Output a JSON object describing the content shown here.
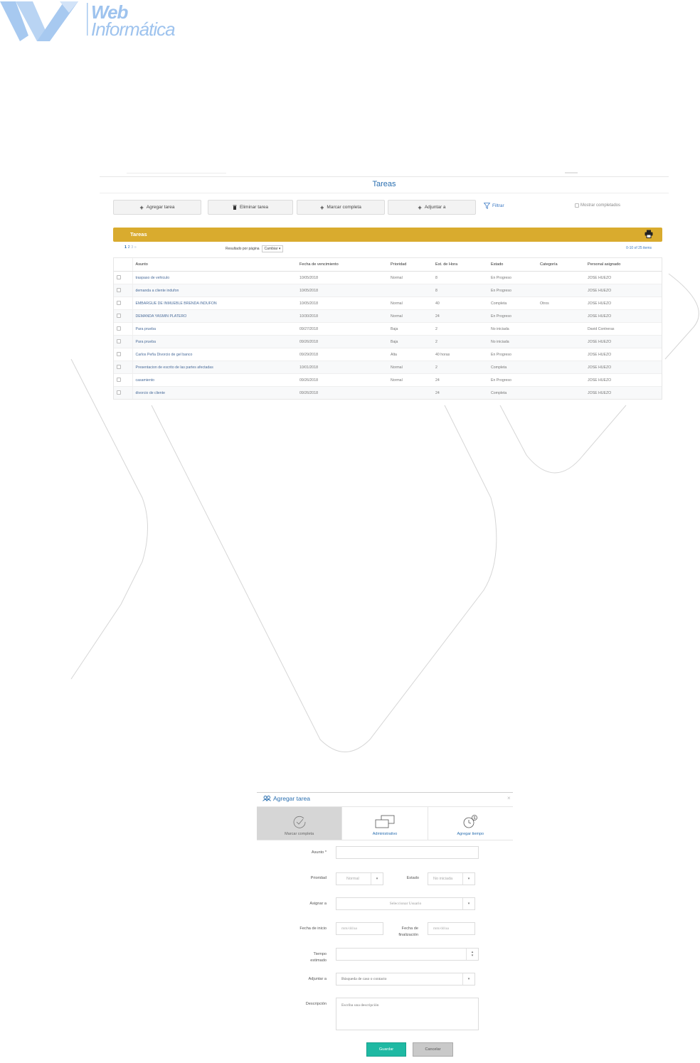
{
  "brand": {
    "line1": "Web",
    "line2": "Informática",
    "color": "#9ec3ee"
  },
  "page": {
    "title": "Tareas"
  },
  "toolbar": {
    "add_task": "Agregar tarea",
    "delete_task": "Eliminar tarea",
    "mark_complete": "Marcar completa",
    "attach_to": "Adjuntar a",
    "filter": "Filtrar",
    "show_completed": "Mostrar completados"
  },
  "panel": {
    "title": "Tareas",
    "accent": "#d9ab2e",
    "pages": [
      "1",
      "2",
      "3",
      "»"
    ],
    "per_page_label": "Resultado por página",
    "per_page_select": "Cambiar",
    "range": "0-10 of 25 items"
  },
  "table": {
    "columns": [
      "",
      "Asunto",
      "Fecha de vencimiento",
      "Prioridad",
      "Est. de Hora",
      "Estado",
      "Categoría",
      "Personal asignado"
    ],
    "rows": [
      [
        "traspaso de vehiculo",
        "10/05/2018",
        "Normal",
        "8",
        "En Progreso",
        "",
        "JOSE HUEZO"
      ],
      [
        "demanda a cliente indufon",
        "10/05/2018",
        "",
        "8",
        "En Progreso",
        "",
        "JOSE HUEZO"
      ],
      [
        "EMBARGUE DE INMUEBLE BRENDA INDUFON",
        "10/05/2018",
        "Normal",
        "40",
        "Completa",
        "Otros",
        "JOSE HUEZO"
      ],
      [
        "DEMANDA YASMIN PLATERO",
        "10/30/2018",
        "Normal",
        "24",
        "En Progreso",
        "",
        "JOSE HUEZO"
      ],
      [
        "Para prueba",
        "09/27/2018",
        "Baja",
        "2",
        "No iniciada",
        "",
        "David Contreras"
      ],
      [
        "Para prueba",
        "09/26/2018",
        "Baja",
        "2",
        "No iniciada",
        "",
        "JOSE HUEZO"
      ],
      [
        "Carlos Peña Divorcio de gel banco",
        "09/29/2018",
        "Alta",
        "40 horas",
        "En Progreso",
        "",
        "JOSE HUEZO"
      ],
      [
        "Presentacion de escrito de las partes afectadas",
        "10/01/2018",
        "Normal",
        "2",
        "Completa",
        "",
        "JOSE HUEZO"
      ],
      [
        "casamiento",
        "09/26/2018",
        "Normal",
        "24",
        "En Progreso",
        "",
        "JOSE HUEZO"
      ],
      [
        "divorcio de cliente",
        "09/26/2018",
        "",
        "24",
        "Completa",
        "",
        "JOSE HUEZO"
      ]
    ]
  },
  "modal": {
    "title": "Agregar tarea",
    "close": "×",
    "tabs": [
      "Marcar completa",
      "Administrativo",
      "Agregar tiempo"
    ],
    "fields": {
      "subject_label": "Asunto *",
      "priority_label": "Prioridad",
      "priority_value": "Normal",
      "status_label": "Estado",
      "status_value": "No iniciada",
      "assign_label": "Asignar a",
      "assign_value": "Seleccionar Usuario",
      "start_label": "Fecha de inicio",
      "start_placeholder": "mm/dd/aa",
      "end_label_1": "Fecha de",
      "end_label_2": "finalización",
      "end_placeholder": "mm/dd/aa",
      "time_label_1": "Tiempo",
      "time_label_2": "estimado",
      "attach_label": "Adjuntar a",
      "attach_placeholder": "Búsqueda de caso o contacto",
      "desc_label": "Descripción",
      "desc_placeholder": "Escriba una descripción"
    },
    "save": "Guardar",
    "cancel": "Cancelar"
  }
}
